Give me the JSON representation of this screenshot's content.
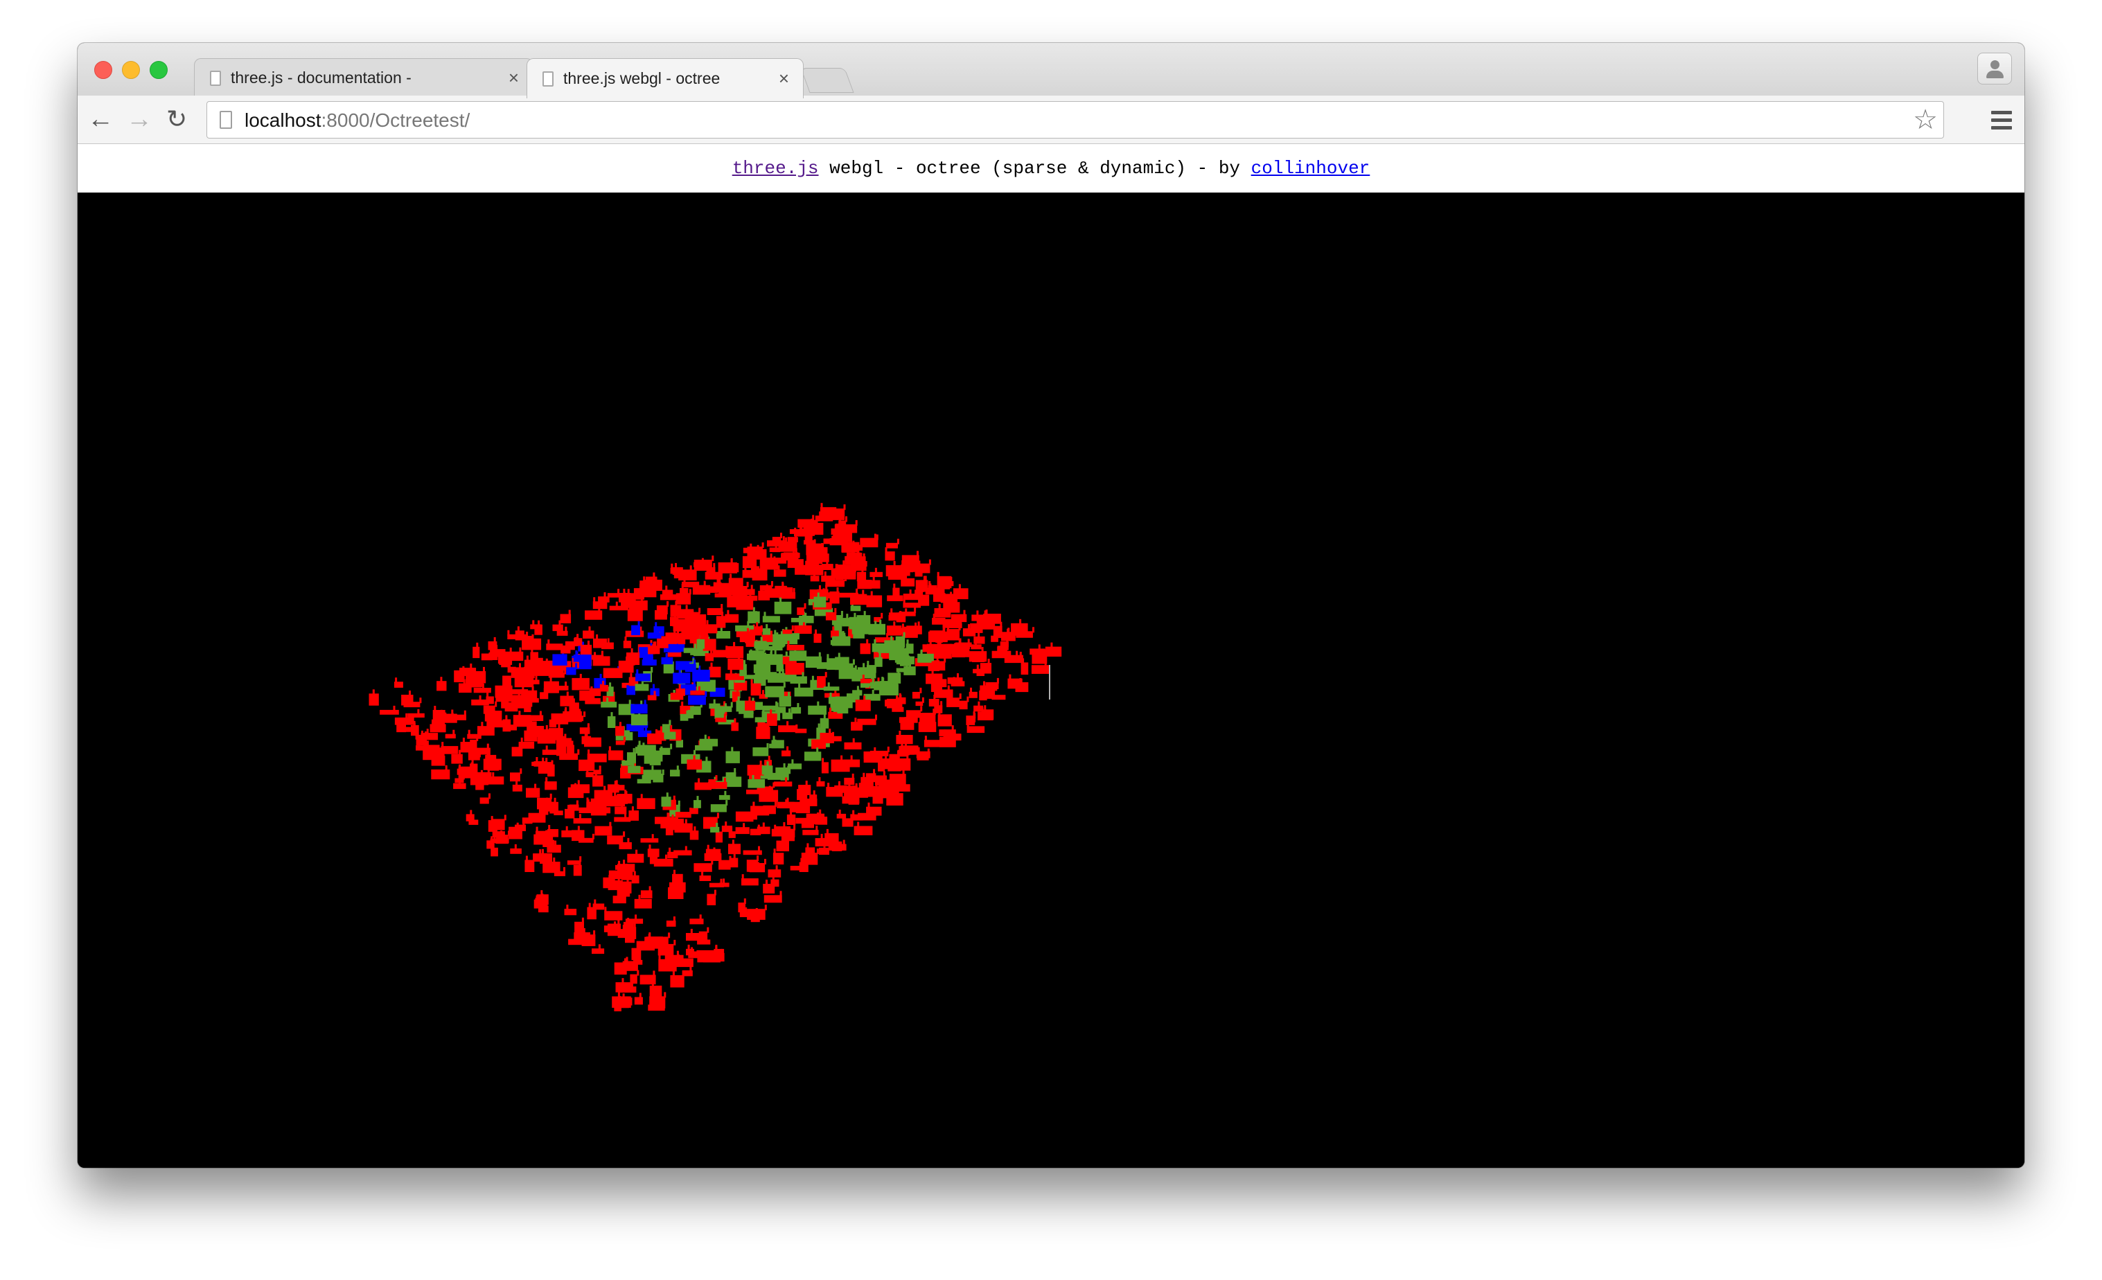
{
  "browser": {
    "tabs": [
      {
        "title": "three.js - documentation -",
        "close": "×",
        "active": false
      },
      {
        "title": "three.js webgl - octree",
        "close": "×",
        "active": true
      }
    ],
    "url_host": "localhost",
    "url_rest": ":8000/Octreetest/"
  },
  "page": {
    "link1": "three.js",
    "middle_text": " webgl - octree (sparse & dynamic) - by ",
    "link2": "collinhover"
  },
  "scene": {
    "background": "#000000",
    "colors": {
      "red": "#ff0000",
      "green": "#5aa02c",
      "blue": "#0000ff"
    }
  },
  "icons": {
    "back": "arrow-left-icon",
    "forward": "arrow-right-icon",
    "reload": "reload-icon",
    "bookmark": "star-icon",
    "menu": "hamburger-menu-icon",
    "profile": "person-icon"
  }
}
